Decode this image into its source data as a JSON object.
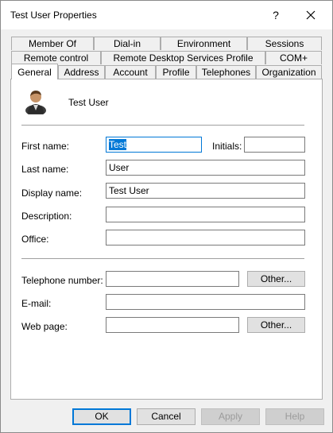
{
  "window": {
    "title": "Test User Properties",
    "help_glyph": "?"
  },
  "tabs": {
    "row1": [
      "Member Of",
      "Dial-in",
      "Environment",
      "Sessions"
    ],
    "row2": [
      "Remote control",
      "Remote Desktop Services Profile",
      "COM+"
    ],
    "row3": [
      "General",
      "Address",
      "Account",
      "Profile",
      "Telephones",
      "Organization"
    ],
    "active": "General"
  },
  "general": {
    "display_header_name": "Test User",
    "fields": {
      "first_name": {
        "label": "First name:",
        "value": "Test"
      },
      "initials": {
        "label": "Initials:",
        "value": ""
      },
      "last_name": {
        "label": "Last name:",
        "value": "User"
      },
      "display_name": {
        "label": "Display name:",
        "value": "Test User"
      },
      "description": {
        "label": "Description:",
        "value": ""
      },
      "office": {
        "label": "Office:",
        "value": ""
      },
      "telephone": {
        "label": "Telephone number:",
        "value": ""
      },
      "email": {
        "label": "E-mail:",
        "value": ""
      },
      "web_page": {
        "label": "Web page:",
        "value": ""
      }
    },
    "other_label": "Other..."
  },
  "footer": {
    "ok": "OK",
    "cancel": "Cancel",
    "apply": "Apply",
    "help": "Help"
  },
  "colors": {
    "accent": "#0078d7",
    "panel": "#ffffff",
    "chrome": "#f0f0f0"
  }
}
